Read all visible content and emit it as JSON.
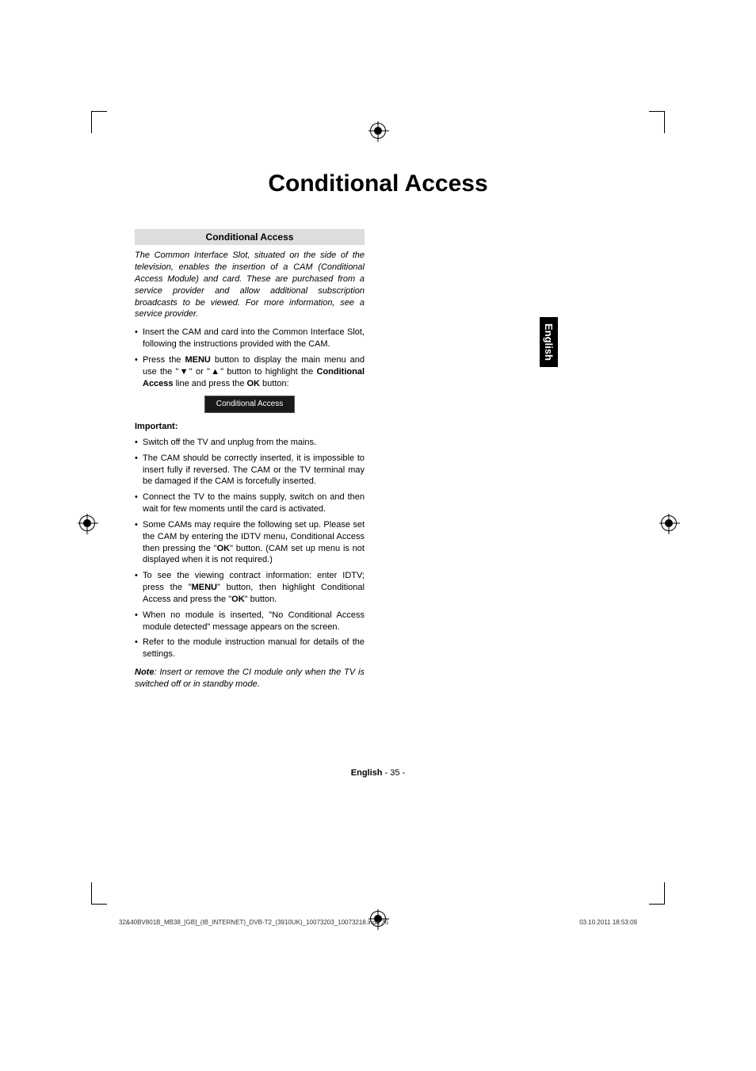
{
  "title": "Conditional Access",
  "side_tab": "English",
  "section_heading": "Conditional Access",
  "intro": "The Common Interface Slot, situated on the side of the television, enables the insertion of a CAM (Conditional Access Module) and card. These are purchased from a service provider and allow additional subscription broadcasts to be viewed. For more information, see a service provider.",
  "list1": {
    "item1": "Insert the CAM and card into the Common Interface Slot, following the instructions provided with the CAM.",
    "item2_a": "Press the ",
    "item2_menu": "MENU",
    "item2_b": " button to display the main menu and use the \"",
    "item2_c": "\" or \"",
    "item2_d": "\" button to highlight the ",
    "item2_ca": "Conditional Access",
    "item2_e": " line and press the ",
    "item2_ok": "OK",
    "item2_f": " button:"
  },
  "menu_bar": "Conditional Access",
  "important": "Important:",
  "list2": {
    "item1": "Switch off the TV and unplug from the mains.",
    "item2": "The CAM should be correctly inserted, it is impossible to insert fully if reversed. The CAM or the TV terminal may be damaged if the CAM is forcefully inserted.",
    "item3": "Connect the TV to the mains supply, switch on and then wait for few moments until the card is activated.",
    "item4_a": "Some CAMs may require the following set up. Please set the CAM by entering the IDTV menu, Conditional Access then pressing the \"",
    "item4_ok": "OK",
    "item4_b": "\" button. (CAM set up menu is not displayed when it is not required.)",
    "item5_a": "To see the viewing contract information: enter IDTV; press the \"",
    "item5_menu": "MENU",
    "item5_b": "\" button, then highlight Conditional Access and press the \"",
    "item5_ok": "OK",
    "item5_c": "\" button.",
    "item6": "When no module is inserted, \"No Conditional Access module detected\" message appears on the screen.",
    "item7": "Refer to the module instruction manual for details of the settings."
  },
  "note_bold": "Note",
  "note": ": Insert or remove the CI module only when the TV is switched off or in standby mode.",
  "footer": {
    "lang": "English",
    "page": "   - 35 -",
    "meta_left": "32&40BV801B_MB38_[GB]_(IB_INTERNET)_DVB-T2_(3910UK)_10073203_10073218.indd   35",
    "meta_right": "03.10.2011   18:53:09"
  },
  "icons": {
    "down": "▼",
    "up": "▲"
  }
}
